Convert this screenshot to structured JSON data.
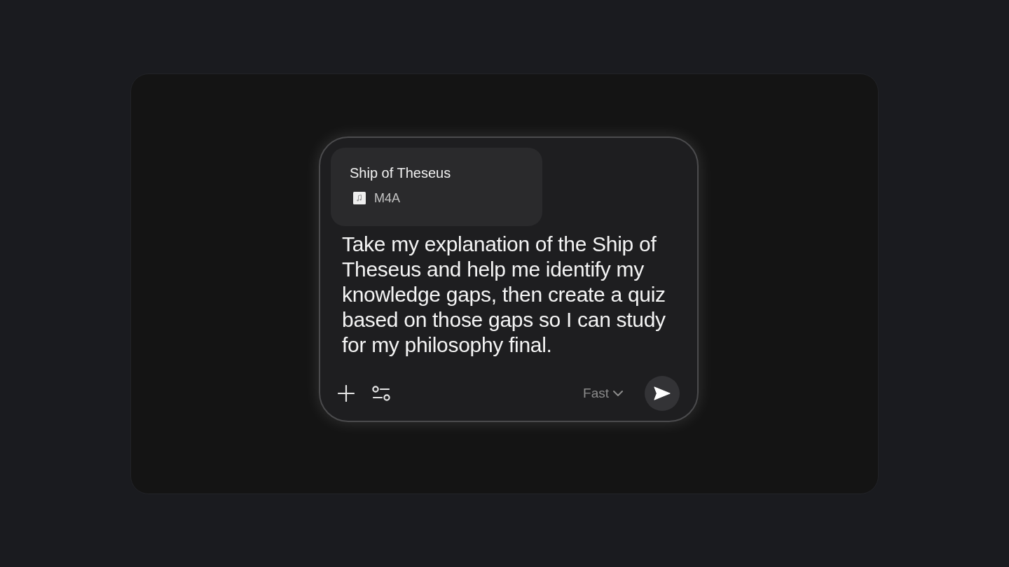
{
  "attachment": {
    "title": "Ship of Theseus",
    "type": "M4A"
  },
  "prompt": {
    "value": "Take my explanation of the Ship of Theseus and help me identify my knowledge gaps, then create a quiz based on those gaps so I can study for my philosophy final."
  },
  "mode_selector": {
    "label": "Fast"
  }
}
